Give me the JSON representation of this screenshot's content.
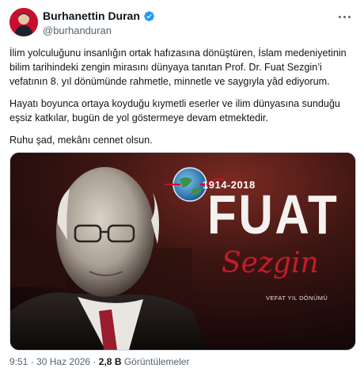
{
  "author": {
    "name": "Burhanettin Duran",
    "handle": "@burhanduran",
    "verified_color": "#1d9bf0"
  },
  "icons": [
    "avatar",
    "verified-badge-icon",
    "more-options-icon",
    "globe-logo"
  ],
  "tweet": {
    "paragraphs": [
      "İlim yolculuğunu insanlığın ortak hafızasına dönüştüren, İslam medeniyetinin bilim tarihindeki zengin mirasını dünyaya tanıtan Prof. Dr. Fuat Sezgin’i vefatının 8. yıl dönümünde rahmetle, minnetle ve saygıyla yâd ediyorum.",
      "Hayatı boyunca ortaya koyduğu kıymetli eserler ve ilim dünyasına sunduğu eşsiz katkılar, bugün de yol göstermeye devam etmektedir.",
      "Ruhu şad, mekânı cennet olsun."
    ]
  },
  "media": {
    "years": "1914-2018",
    "first_name": "FUAT",
    "last_name": "Sezgin",
    "subtitle": "VEFAT YIL DÖNÜMÜ"
  },
  "meta": {
    "time": "9:51",
    "date": "30 Haz 2026",
    "views": "2,8 B",
    "views_label": "Görüntülemeler"
  }
}
